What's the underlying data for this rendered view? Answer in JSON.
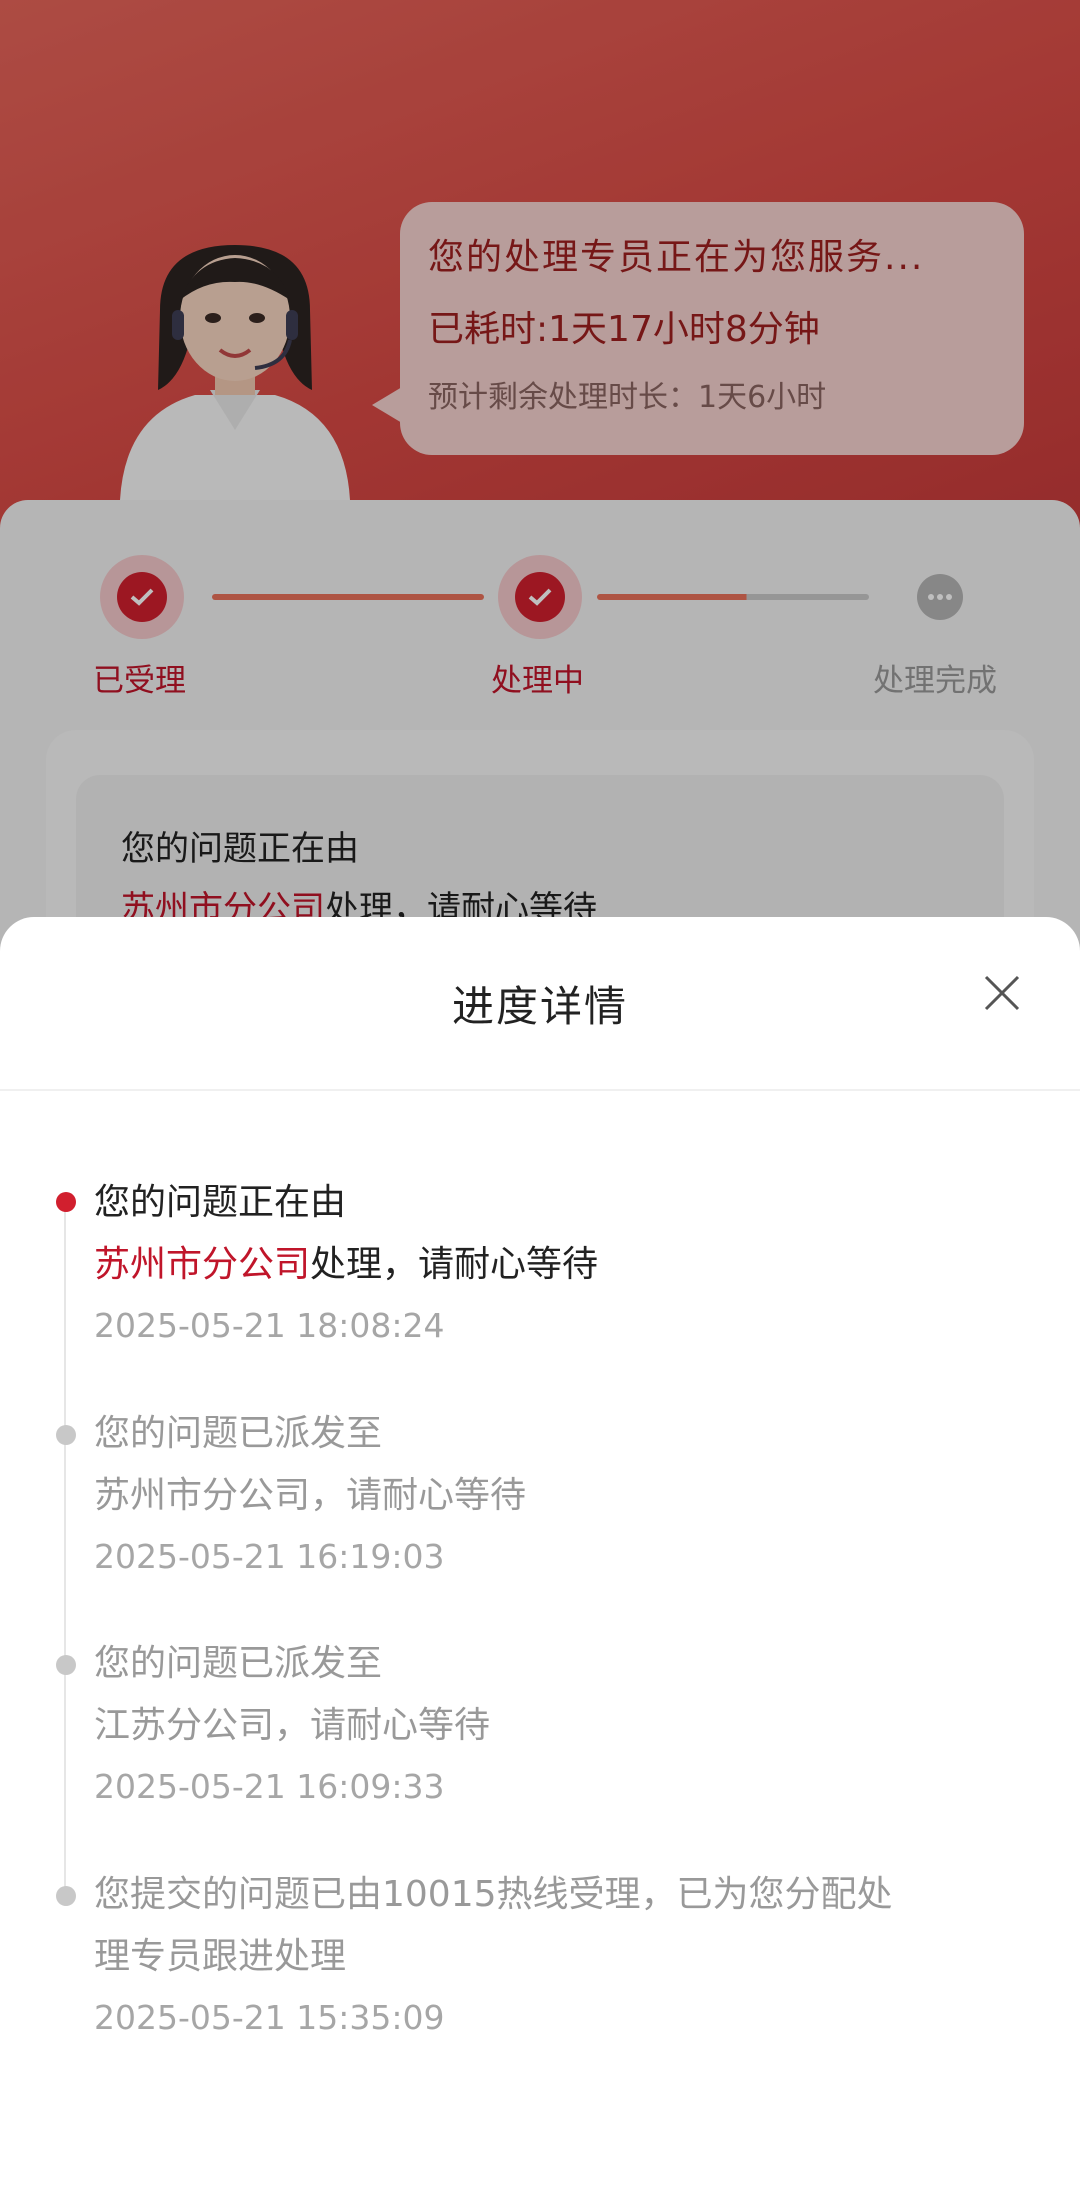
{
  "banner": {
    "title": "您的处理专员正在为您服务...",
    "elapsed": "已耗时:1天17小时8分钟",
    "remaining": "预计剩余处理时长：1天6小时"
  },
  "steps": [
    {
      "label": "已受理",
      "status": "done"
    },
    {
      "label": "处理中",
      "status": "active"
    },
    {
      "label": "处理完成",
      "status": "pending"
    }
  ],
  "status_card": {
    "line1": "您的问题正在由",
    "office": "苏州市分公司",
    "line2_rest": "处理，请耐心等待"
  },
  "sheet": {
    "title": "进度详情",
    "timeline": [
      {
        "line1": "您的问题正在由",
        "highlight": "苏州市分公司",
        "line2": "处理，请耐心等待",
        "time": "2025-05-21 18:08:24",
        "active": true
      },
      {
        "line1": "您的问题已派发至",
        "line2": "苏州市分公司，请耐心等待",
        "time": "2025-05-21 16:19:03",
        "active": false
      },
      {
        "line1": "您的问题已派发至",
        "line2": "江苏分公司，请耐心等待",
        "time": "2025-05-21 16:09:33",
        "active": false
      },
      {
        "line1": "您提交的问题已由10015热线受理，已为您分配处",
        "line2": "理专员跟进处理",
        "time": "2025-05-21 15:35:09",
        "active": false
      }
    ]
  },
  "colors": {
    "accent": "#c0152a",
    "hero": "#d94a45",
    "muted": "#999999"
  }
}
